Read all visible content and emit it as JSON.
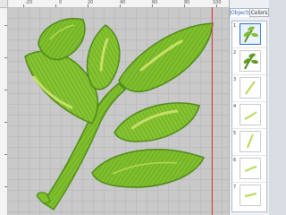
{
  "panel": {
    "tabs": [
      {
        "label": "Objects",
        "active": true
      },
      {
        "label": "Colors",
        "active": false
      }
    ],
    "objects": [
      {
        "num": "1",
        "thumb": "branch-thumb-icon",
        "selected": true
      },
      {
        "num": "2",
        "thumb": "leaves-thumb-icon",
        "selected": false
      },
      {
        "num": "3",
        "thumb": "vein-thumb-icon",
        "selected": false
      },
      {
        "num": "4",
        "thumb": "vein-thumb-icon",
        "selected": false
      },
      {
        "num": "5",
        "thumb": "vein-thumb-icon",
        "selected": false
      },
      {
        "num": "6",
        "thumb": "vein-thumb-icon",
        "selected": false
      },
      {
        "num": "7",
        "thumb": "vein-thumb-icon",
        "selected": false
      }
    ]
  },
  "ruler": {
    "top_labels": [
      "-20",
      "0",
      "20",
      "40",
      "60",
      "80",
      "100"
    ]
  },
  "colors": {
    "leaf_green": "#7fbf2c",
    "leaf_dark": "#4e8a18",
    "leaf_light": "#c8e06a",
    "guide_red": "#e03b3b",
    "selection_blue": "#2e6fd2"
  }
}
